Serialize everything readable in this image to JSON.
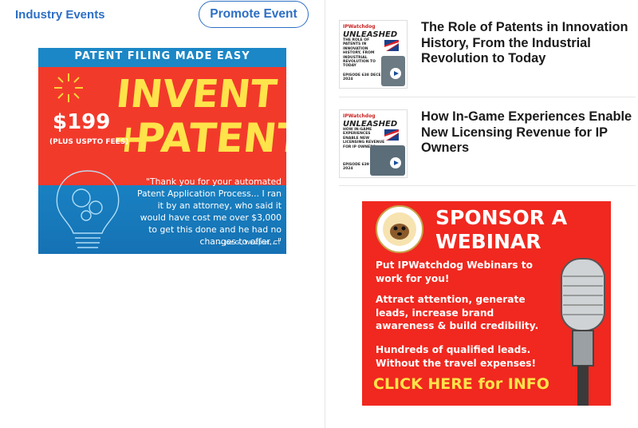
{
  "left": {
    "events_link": "Industry Events",
    "promote_button": "Promote Event",
    "ad": {
      "topbar": "PATENT FILING MADE EASY",
      "headline_1": "INVENT +",
      "headline_2": "PATENT",
      "price": "$199",
      "fees": "(PLUS USPTO FEES)",
      "quote": "\"Thank you for your automated Patent Application Process... I ran it by an attorney, who said it would have cost me over $3,000 to get this done and he had no changes to offer...\"",
      "attribution": "— Joe G., Westport, CT"
    }
  },
  "articles": [
    {
      "title": "The Role of Patents in Innovation History, From the Industrial Revolution to Today",
      "thumb_logo": "UNLEASHED",
      "thumb_logo_small": "IPWatchdog",
      "thumb_text": "THE ROLE OF PATENTS IN INNOVATION HISTORY, FROM INDUSTRIAL REVOLUTION TO TODAY",
      "thumb_episode": "EPISODE 638 DECEMBER 20, 2024"
    },
    {
      "title": "How In-Game Experiences Enable New Licensing Revenue for IP Owners",
      "thumb_logo": "UNLEASHED",
      "thumb_logo_small": "IPWatchdog",
      "thumb_text": "HOW IN-GAME EXPERIENCES ENABLE NEW LICENSING REVENUE FOR IP OWNERS",
      "thumb_episode": "EPISODE 639 DECEMBER 23, 2024"
    }
  ],
  "webinar_ad": {
    "heading_1": "SPONSOR A",
    "heading_2": "WEBINAR",
    "p1_line1": "Put IPWatchdog Webinars to",
    "p1_line2": "work for you!",
    "p2_line1": "Attract attention, generate",
    "p2_line2": "leads, increase brand",
    "p2_line3": "awareness & build credibility.",
    "p3_line1": "Hundreds of qualified leads.",
    "p3_line2": "Without the travel expenses!",
    "cta": "CLICK HERE for INFO"
  },
  "colors": {
    "link": "#2d6fc4",
    "ad_red": "#f23a2b",
    "ad_yellow": "#ffe34a",
    "ad_blue": "#1b88c8"
  }
}
